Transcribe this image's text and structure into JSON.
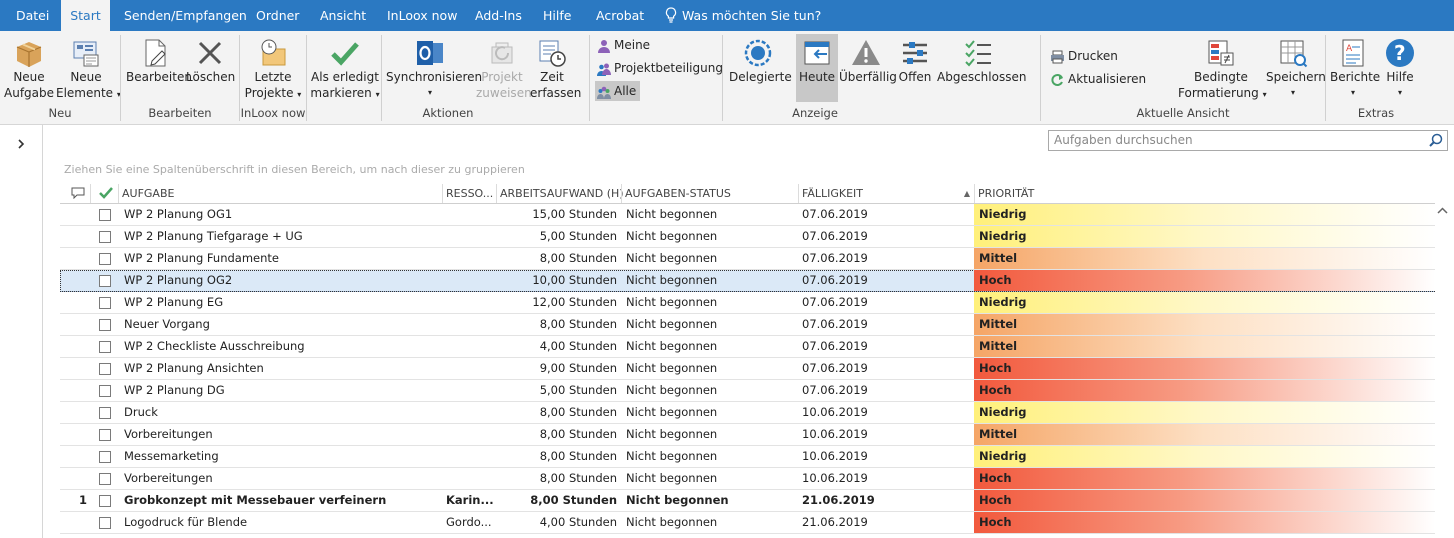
{
  "menu": {
    "items": [
      "Datei",
      "Start",
      "Senden/Empfangen",
      "Ordner",
      "Ansicht",
      "InLoox now",
      "Add-Ins",
      "Hilfe",
      "Acrobat"
    ],
    "active": "Start",
    "tell_me": "Was möchten Sie tun?"
  },
  "ribbon": {
    "groups": {
      "neu": "Neu",
      "bearbeiten": "Bearbeiten",
      "inloox_now": "InLoox now",
      "aktionen": "Aktionen",
      "anzeige": "Anzeige",
      "aktuelle_ansicht": "Aktuelle Ansicht",
      "extras": "Extras"
    },
    "neue_aufgabe": [
      "Neue",
      "Aufgabe"
    ],
    "neue_elemente": [
      "Neue",
      "Elemente"
    ],
    "bearbeiten": "Bearbeiten",
    "loeschen": "Löschen",
    "letzte_projekte": [
      "Letzte",
      "Projekte"
    ],
    "als_erledigt": [
      "Als erledigt",
      "markieren"
    ],
    "synchronisieren": "Synchronisieren",
    "projekt_zuweisen": [
      "Projekt",
      "zuweisen"
    ],
    "zeit_erfassen": [
      "Zeit",
      "erfassen"
    ],
    "meine": "Meine",
    "projektbeteiligung": "Projektbeteiligung",
    "alle": "Alle",
    "delegierte": "Delegierte",
    "heute": "Heute",
    "ueberfaellig": "Überfällig",
    "offen": "Offen",
    "abgeschlossen": "Abgeschlossen",
    "drucken": "Drucken",
    "aktualisieren": "Aktualisieren",
    "bedingte_formatierung": [
      "Bedingte",
      "Formatierung"
    ],
    "speichern": "Speichern",
    "berichte": "Berichte",
    "hilfe": "Hilfe"
  },
  "search": {
    "placeholder": "Aufgaben durchsuchen"
  },
  "group_hint": "Ziehen Sie eine Spaltenüberschrift in diesen Bereich, um nach dieser zu gruppieren",
  "columns": {
    "aufgabe": "AUFGABE",
    "ressource": "RESSO...",
    "arbeitsaufwand": "ARBEITSAUFWAND (H)",
    "status": "AUFGABEN-STATUS",
    "faelligkeit": "FÄLLIGKEIT",
    "prioritaet": "PRIORITÄT"
  },
  "colors": {
    "accent": "#2b79c2",
    "hoch": "#f2593d",
    "mittel": "#f5a566",
    "niedrig": "#fff07a"
  },
  "rows": [
    {
      "num": "",
      "task": "WP 2 Planung OG1",
      "res": "",
      "effort": "15,00 Stunden",
      "status": "Nicht begonnen",
      "due": "07.06.2019",
      "prio": "Niedrig"
    },
    {
      "num": "",
      "task": "WP 2 Planung Tiefgarage + UG",
      "res": "",
      "effort": "5,00 Stunden",
      "status": "Nicht begonnen",
      "due": "07.06.2019",
      "prio": "Niedrig"
    },
    {
      "num": "",
      "task": "WP 2 Planung Fundamente",
      "res": "",
      "effort": "8,00 Stunden",
      "status": "Nicht begonnen",
      "due": "07.06.2019",
      "prio": "Mittel"
    },
    {
      "num": "",
      "task": "WP 2 Planung OG2",
      "res": "",
      "effort": "10,00 Stunden",
      "status": "Nicht begonnen",
      "due": "07.06.2019",
      "prio": "Hoch",
      "selected": true
    },
    {
      "num": "",
      "task": "WP 2 Planung EG",
      "res": "",
      "effort": "12,00 Stunden",
      "status": "Nicht begonnen",
      "due": "07.06.2019",
      "prio": "Niedrig"
    },
    {
      "num": "",
      "task": "Neuer Vorgang",
      "res": "",
      "effort": "8,00 Stunden",
      "status": "Nicht begonnen",
      "due": "07.06.2019",
      "prio": "Mittel"
    },
    {
      "num": "",
      "task": "WP 2 Checkliste Ausschreibung",
      "res": "",
      "effort": "4,00 Stunden",
      "status": "Nicht begonnen",
      "due": "07.06.2019",
      "prio": "Mittel"
    },
    {
      "num": "",
      "task": "WP 2 Planung Ansichten",
      "res": "",
      "effort": "9,00 Stunden",
      "status": "Nicht begonnen",
      "due": "07.06.2019",
      "prio": "Hoch"
    },
    {
      "num": "",
      "task": "WP 2 Planung DG",
      "res": "",
      "effort": "5,00 Stunden",
      "status": "Nicht begonnen",
      "due": "07.06.2019",
      "prio": "Hoch"
    },
    {
      "num": "",
      "task": "Druck",
      "res": "",
      "effort": "8,00 Stunden",
      "status": "Nicht begonnen",
      "due": "10.06.2019",
      "prio": "Niedrig"
    },
    {
      "num": "",
      "task": "Vorbereitungen",
      "res": "",
      "effort": "8,00 Stunden",
      "status": "Nicht begonnen",
      "due": "10.06.2019",
      "prio": "Mittel"
    },
    {
      "num": "",
      "task": "Messemarketing",
      "res": "",
      "effort": "8,00 Stunden",
      "status": "Nicht begonnen",
      "due": "10.06.2019",
      "prio": "Niedrig"
    },
    {
      "num": "",
      "task": "Vorbereitungen",
      "res": "",
      "effort": "8,00 Stunden",
      "status": "Nicht begonnen",
      "due": "10.06.2019",
      "prio": "Hoch"
    },
    {
      "num": "1",
      "task": "Grobkonzept mit Messebauer verfeinern",
      "res": "Karin...",
      "effort": "8,00 Stunden",
      "status": "Nicht begonnen",
      "due": "21.06.2019",
      "prio": "Hoch",
      "bold": true
    },
    {
      "num": "",
      "task": "Logodruck für Blende",
      "res": "Gordo...",
      "effort": "4,00 Stunden",
      "status": "Nicht begonnen",
      "due": "21.06.2019",
      "prio": "Hoch"
    }
  ]
}
